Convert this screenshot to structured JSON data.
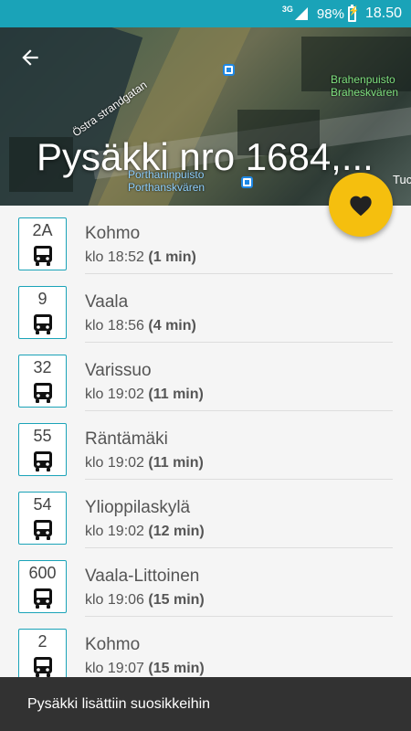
{
  "status_bar": {
    "network": "3G",
    "battery": "98%",
    "time": "18.50"
  },
  "map": {
    "street_label": "Östra strandgatan",
    "park_top_line1": "Brahenpuisto",
    "park_top_line2": "Braheskvären",
    "park_bottom_line1": "Porthaninpuisto",
    "park_bottom_line2": "Porthanskvären",
    "road_label": "Tuc"
  },
  "header": {
    "title": "Pysäkki nro 1684,..."
  },
  "departures": [
    {
      "route": "2A",
      "destination": "Kohmo",
      "time": "klo 18:52",
      "wait": "(1 min)"
    },
    {
      "route": "9",
      "destination": "Vaala",
      "time": "klo 18:56",
      "wait": "(4 min)"
    },
    {
      "route": "32",
      "destination": "Varissuo",
      "time": "klo 19:02",
      "wait": "(11 min)"
    },
    {
      "route": "55",
      "destination": "Räntämäki",
      "time": "klo 19:02",
      "wait": "(11 min)"
    },
    {
      "route": "54",
      "destination": "Ylioppilaskylä",
      "time": "klo 19:02",
      "wait": "(12 min)"
    },
    {
      "route": "600",
      "destination": "Vaala-Littoinen",
      "time": "klo 19:06",
      "wait": "(15 min)"
    },
    {
      "route": "2",
      "destination": "Kohmo",
      "time": "klo 19:07",
      "wait": "(15 min)"
    }
  ],
  "snackbar": {
    "message": "Pysäkki lisättiin suosikkeihin"
  },
  "colors": {
    "accent": "#1aa3b8",
    "fab": "#f5bf0e",
    "snackbar": "#323232"
  },
  "icons": [
    "back-arrow-icon",
    "heart-icon",
    "bus-icon",
    "signal-icon",
    "battery-icon"
  ]
}
